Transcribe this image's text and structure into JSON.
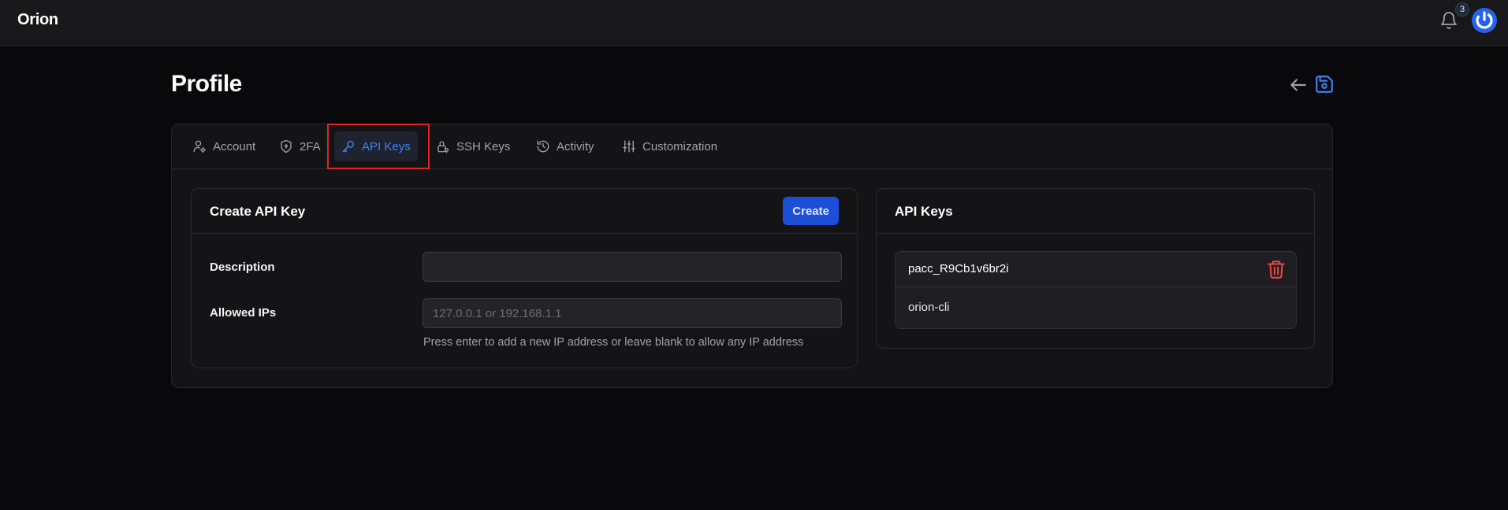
{
  "app": {
    "name": "Orion"
  },
  "header": {
    "notification_count": "3"
  },
  "page": {
    "title": "Profile"
  },
  "tabs": [
    {
      "label": "Account",
      "icon": "user-gear-icon",
      "active": false
    },
    {
      "label": "2FA",
      "icon": "shield-icon",
      "active": false
    },
    {
      "label": "API Keys",
      "icon": "key-icon",
      "active": true
    },
    {
      "label": "SSH Keys",
      "icon": "lock-key-icon",
      "active": false
    },
    {
      "label": "Activity",
      "icon": "history-icon",
      "active": false
    },
    {
      "label": "Customization",
      "icon": "sliders-icon",
      "active": false
    }
  ],
  "create_panel": {
    "title": "Create API Key",
    "create_label": "Create",
    "description_label": "Description",
    "description_value": "",
    "allowed_ips_label": "Allowed IPs",
    "allowed_ips_placeholder": "127.0.0.1 or 192.168.1.1",
    "hint": "Press enter to add a new IP address or leave blank to allow any IP address"
  },
  "keys_panel": {
    "title": "API Keys",
    "keys": [
      {
        "id": "pacc_R9Cb1v6br2i",
        "name": "orion-cli"
      }
    ]
  },
  "colors": {
    "accent": "#3b82f6",
    "primary_button": "#1d4ed8",
    "danger": "#ef4444",
    "highlight_border": "#dc2626",
    "background": "#09090b"
  }
}
